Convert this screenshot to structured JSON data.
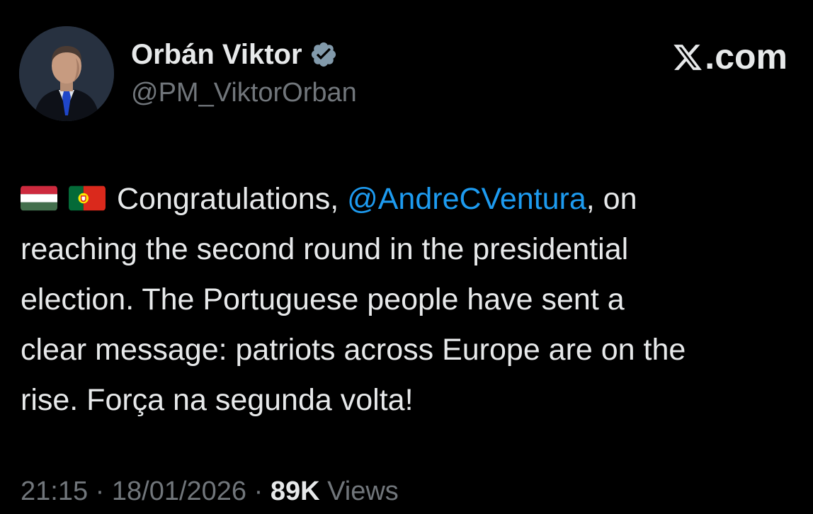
{
  "author": {
    "display_name": "Orbán Viktor",
    "handle": "@PM_ViktorOrban",
    "verified": true,
    "avatar_icon": "profile-photo"
  },
  "brand": {
    "label": ".com",
    "logo_icon": "x-logo-icon"
  },
  "tweet": {
    "flags": [
      "hungary-flag-icon",
      "portugal-flag-icon"
    ],
    "line1_before": "Congratulations, ",
    "mention": "@AndreCVentura",
    "line1_after": ", on",
    "line2": "reaching the second round in the presidential",
    "line3": "election. The Portuguese people have sent a",
    "line4": "clear message: patriots across Europe are on the",
    "line5": "rise. Força na segunda volta!"
  },
  "meta": {
    "time": "21:15",
    "separator1": " · ",
    "date": "18/01/2026",
    "separator2": " · ",
    "views_count": "89K",
    "views_label": " Views"
  },
  "colors": {
    "background": "#000000",
    "primary_text": "#e7e9ea",
    "secondary_text": "#71767b",
    "mention": "#1d9bf0",
    "verified_badge": "#829aab"
  }
}
